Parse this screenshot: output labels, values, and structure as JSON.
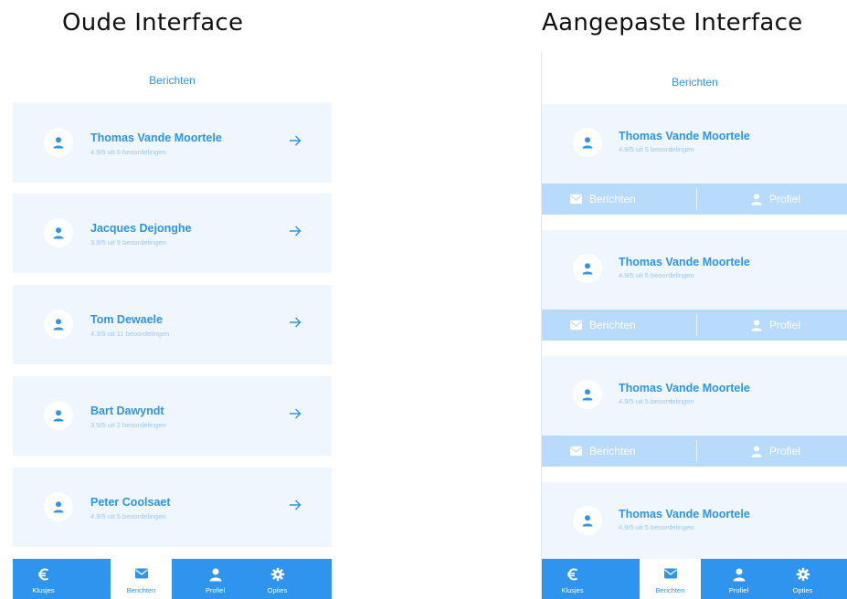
{
  "titles": {
    "left": "Oude Interface",
    "right": "Aangepaste Interface"
  },
  "screen_title": "Berichten",
  "old_interface": {
    "contacts": [
      {
        "name": "Thomas Vande Moortele",
        "rating": "4.9/5 uit 5 beoordelingen"
      },
      {
        "name": "Jacques Dejonghe",
        "rating": "3.9/5 uit 9 beoordelingen"
      },
      {
        "name": "Tom Dewaele",
        "rating": "4.3/5 uit 11 beoordelingen"
      },
      {
        "name": "Bart Dawyndt",
        "rating": "3.5/5 uit 2 beoordelingen"
      },
      {
        "name": "Peter Coolsaet",
        "rating": "4.9/5 uit 5 beoordelingen"
      }
    ]
  },
  "new_interface": {
    "contacts": [
      {
        "name": "Thomas Vande Moortele",
        "rating": "4.9/5 uit 5 beoordelingen"
      },
      {
        "name": "Thomas Vande Moortele",
        "rating": "4.9/5 uit 5 beoordelingen"
      },
      {
        "name": "Thomas Vande Moortele",
        "rating": "4.9/5 uit 5 beoordelingen"
      },
      {
        "name": "Thomas Vande Moortele",
        "rating": "4.9/5 uit 5 beoordelingen"
      }
    ],
    "actions": {
      "messages": "Berichten",
      "profile": "Profiel"
    }
  },
  "tabs": [
    {
      "label": "Klusjes",
      "icon": "euro-icon"
    },
    {
      "label": "Berichten",
      "icon": "mail-icon",
      "active": true
    },
    {
      "label": "Profiel",
      "icon": "user-icon"
    },
    {
      "label": "Opties",
      "icon": "gear-icon"
    }
  ],
  "colors": {
    "accent": "#2e94ee",
    "card_background": "#eff6fd",
    "action_bar": "#b8dbfb",
    "subtext": "#9ec8f0"
  }
}
